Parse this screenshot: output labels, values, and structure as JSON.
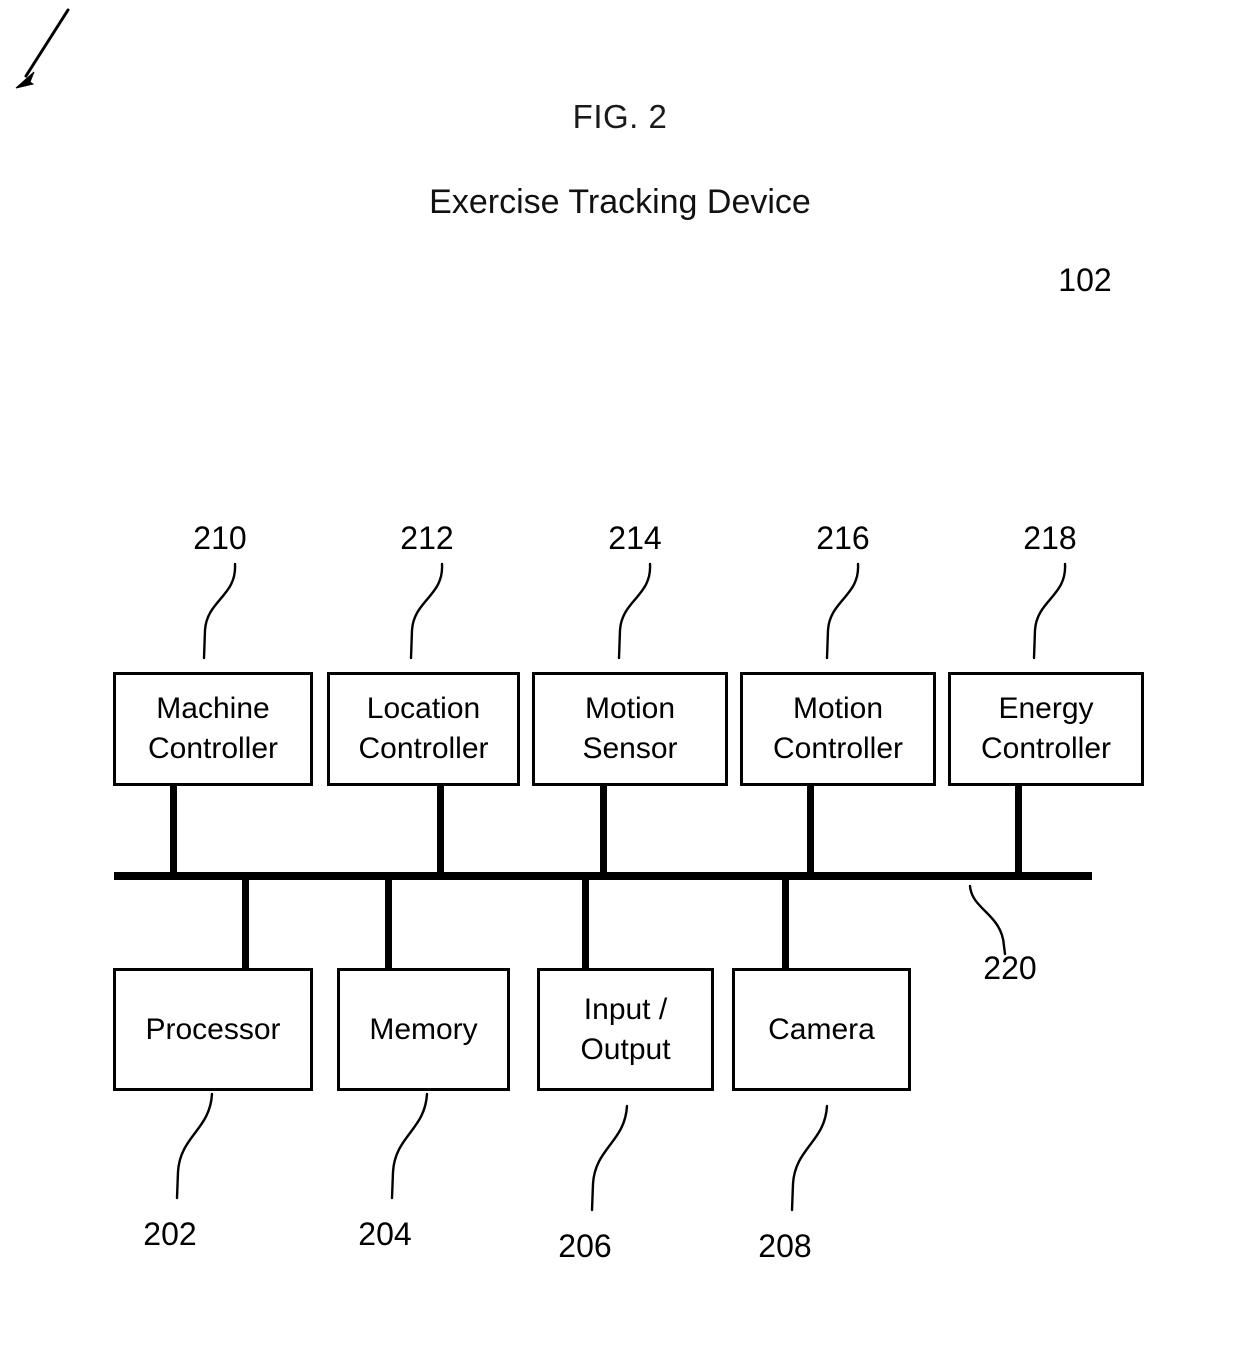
{
  "figure": {
    "fig_label": "FIG. 2",
    "title": "Exercise Tracking Device",
    "device_ref": "102"
  },
  "top_row": [
    {
      "label": "Machine\nController",
      "ref": "210"
    },
    {
      "label": "Location\nController",
      "ref": "212"
    },
    {
      "label": "Motion\nSensor",
      "ref": "214"
    },
    {
      "label": "Motion\nController",
      "ref": "216"
    },
    {
      "label": "Energy\nController",
      "ref": "218"
    }
  ],
  "bottom_row": [
    {
      "label": "Processor",
      "ref": "202"
    },
    {
      "label": "Memory",
      "ref": "204"
    },
    {
      "label": "Input /\nOutput",
      "ref": "206"
    },
    {
      "label": "Camera",
      "ref": "208"
    }
  ],
  "bus": {
    "ref": "220"
  },
  "colors": {
    "ink": "#000000",
    "background": "#ffffff"
  }
}
